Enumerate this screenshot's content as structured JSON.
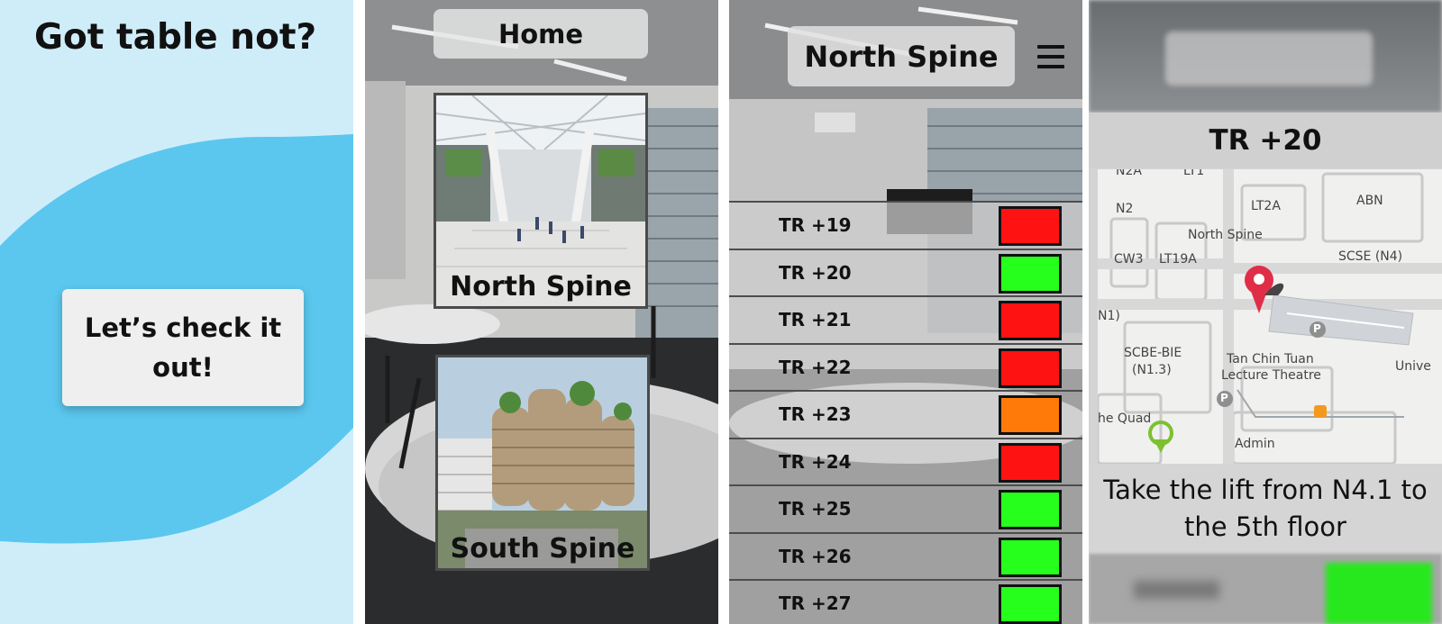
{
  "screen1": {
    "title": "Got table not?",
    "cta_label": "Let’s check it out!",
    "colors": {
      "background": "#cfedf9",
      "wave": "#5bc7ee",
      "button": "#efefef"
    }
  },
  "screen2": {
    "header_title": "Home",
    "cards": [
      {
        "label": "North Spine",
        "image": "north-spine-photo"
      },
      {
        "label": "South Spine",
        "image": "south-spine-photo"
      }
    ]
  },
  "screen3": {
    "header_title": "North Spine",
    "menu_icon": "hamburger-menu-icon",
    "rooms": [
      {
        "label": "TR +19",
        "status": "red"
      },
      {
        "label": "TR +20",
        "status": "green"
      },
      {
        "label": "TR +21",
        "status": "red"
      },
      {
        "label": "TR +22",
        "status": "red"
      },
      {
        "label": "TR +23",
        "status": "orange"
      },
      {
        "label": "TR +24",
        "status": "red"
      },
      {
        "label": "TR +25",
        "status": "green"
      },
      {
        "label": "TR +26",
        "status": "green"
      },
      {
        "label": "TR +27",
        "status": "green"
      }
    ],
    "status_colors": {
      "red": "#ff1212",
      "green": "#26ff1c",
      "orange": "#ff7a08"
    }
  },
  "screen4": {
    "room_title": "TR +20",
    "map_labels": {
      "top_a": "N2A",
      "top_b": "LT1",
      "n2": "N2",
      "lt2a": "LT2A",
      "abn": "ABN",
      "north_spine": "North Spine",
      "cw3": "CW3",
      "lt19a": "LT19A",
      "scse": "SCSE (N4)",
      "n1": "N1)",
      "scbe": "SCBE-BIE",
      "n13": "(N1.3)",
      "tan_chin_tuan": "Tan Chin Tuan",
      "lecture_theatre": "Lecture Theatre",
      "univ": "Unive",
      "quad": "he Quad",
      "admin": "Admin",
      "p1": "P",
      "p2": "P"
    },
    "directions": "Take the lift from N4.1 to the 5th floor"
  }
}
